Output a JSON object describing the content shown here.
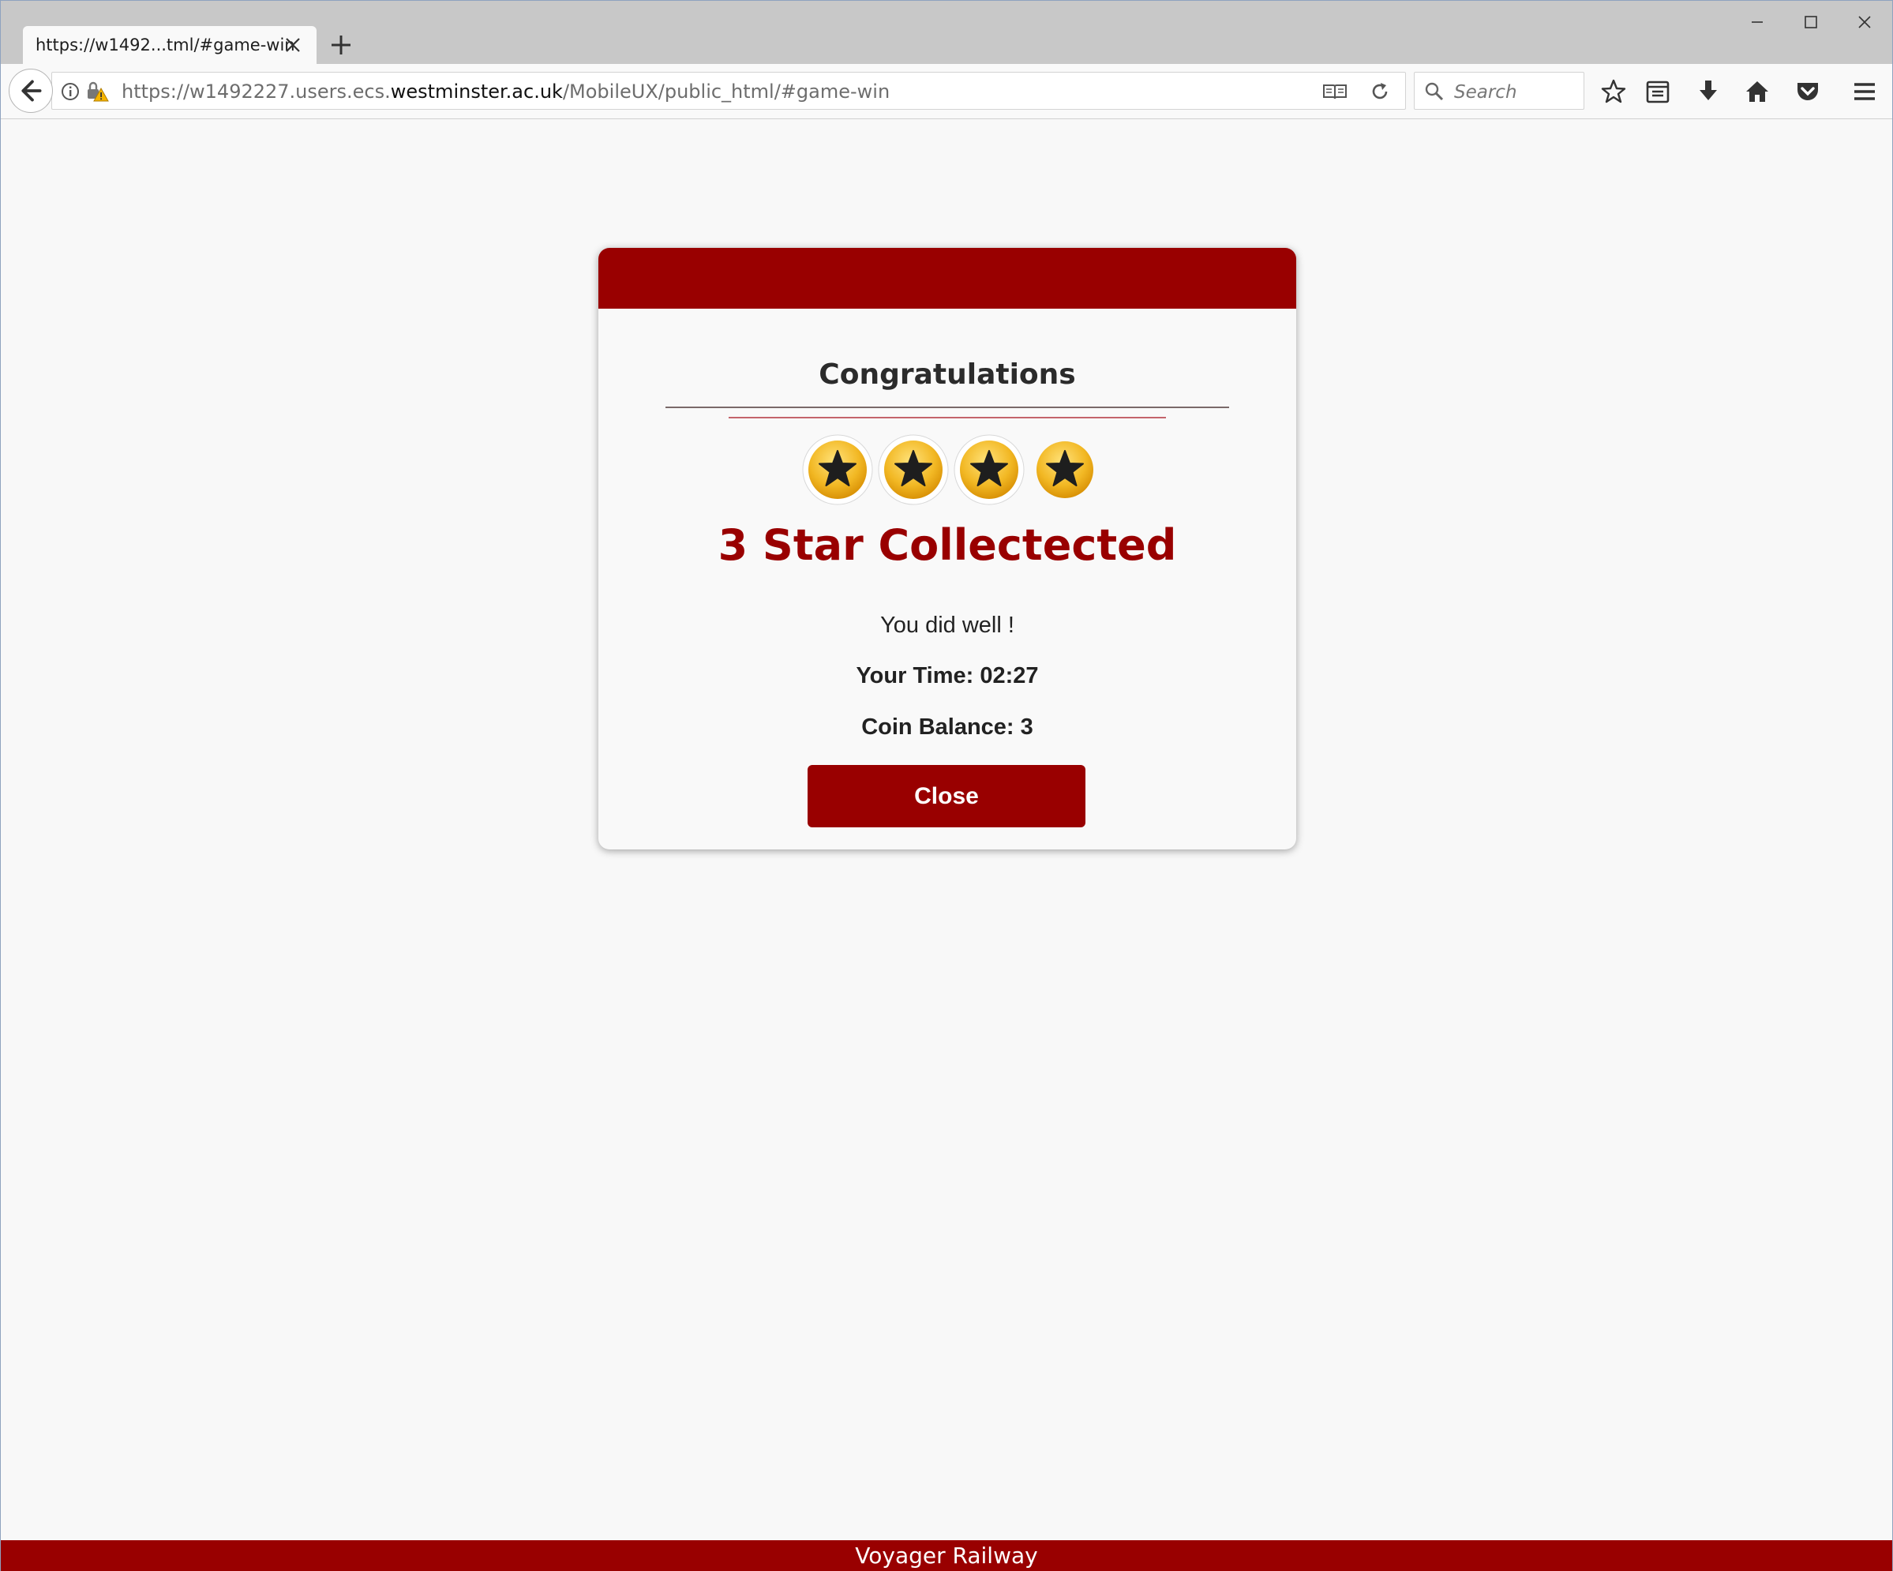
{
  "browser": {
    "tab_title": "https://w1492...tml/#game-win",
    "url_prefix": "https://w1492227.users.ecs.",
    "url_domain": "westminster.ac.uk",
    "url_path": "/MobileUX/public_html/#game-win",
    "search_placeholder": "Search"
  },
  "dialog": {
    "title": "Congratulations",
    "stars_total": 4,
    "stars_collected": 3,
    "headline": "3 Star Collectected",
    "message": "You did well !",
    "time_label": "Your Time: 02:27",
    "coin_label": "Coin Balance: 3",
    "close_label": "Close"
  },
  "footer": {
    "text": "Voyager Railway"
  },
  "colors": {
    "brand": "#990000",
    "coin_gold": "#f2b824",
    "chrome": "#c8c8c8"
  },
  "icons": [
    "back-arrow-icon",
    "info-icon",
    "lock-warning-icon",
    "reader-view-icon",
    "reload-icon",
    "search-icon",
    "bookmark-star-icon",
    "library-icon",
    "download-icon",
    "home-icon",
    "pocket-icon",
    "menu-icon",
    "star-icon"
  ]
}
